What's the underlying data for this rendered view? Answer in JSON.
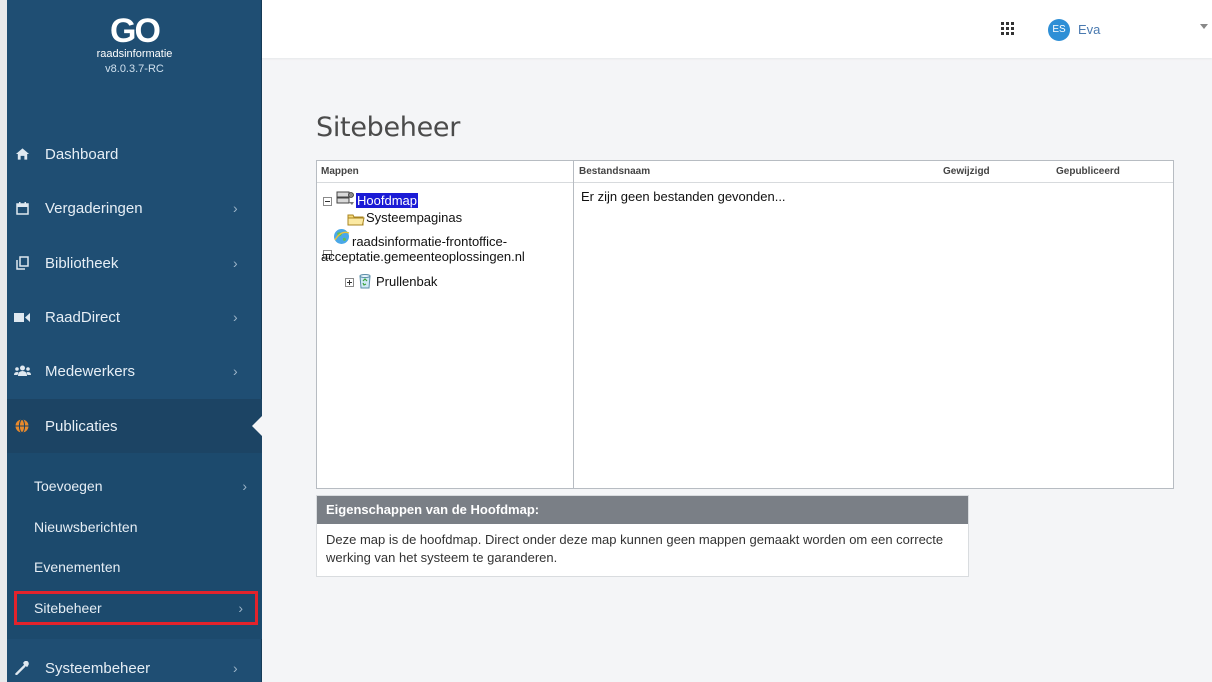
{
  "brand": {
    "logo_text": "GO",
    "product": "raadsinformatie",
    "version": "v8.0.3.7-RC"
  },
  "sidebar": {
    "items": [
      {
        "label": "Dashboard",
        "icon": "home-icon"
      },
      {
        "label": "Vergaderingen",
        "icon": "calendar-icon"
      },
      {
        "label": "Bibliotheek",
        "icon": "copy-icon"
      },
      {
        "label": "RaadDirect",
        "icon": "video-camera-icon"
      },
      {
        "label": "Medewerkers",
        "icon": "users-icon"
      },
      {
        "label": "Publicaties",
        "icon": "globe-icon"
      },
      {
        "label": "Systeembeheer",
        "icon": "wrench-icon"
      }
    ],
    "sub_items": [
      {
        "label": "Toevoegen"
      },
      {
        "label": "Nieuwsberichten"
      },
      {
        "label": "Evenementen"
      },
      {
        "label": "Sitebeheer"
      }
    ]
  },
  "topbar": {
    "user_initials": "ES",
    "user_name": "Eva"
  },
  "main": {
    "title": "Sitebeheer",
    "columns": {
      "folders": "Mappen",
      "filename": "Bestandsnaam",
      "modified": "Gewijzigd",
      "published": "Gepubliceerd"
    },
    "tree": {
      "root": "Hoofdmap",
      "system_pages": "Systeempaginas",
      "site_line1": "raadsinformatie-frontoffice-",
      "site_line2": "acceptatie.gemeenteoplossingen.nl",
      "trash": "Prullenbak"
    },
    "empty_message": "Er zijn geen bestanden gevonden...",
    "properties": {
      "title": "Eigenschappen van de Hoofdmap:",
      "description": "Deze map is de hoofdmap. Direct onder deze map kunnen geen mappen gemaakt worden om een correcte werking van het systeem te garanderen."
    }
  }
}
